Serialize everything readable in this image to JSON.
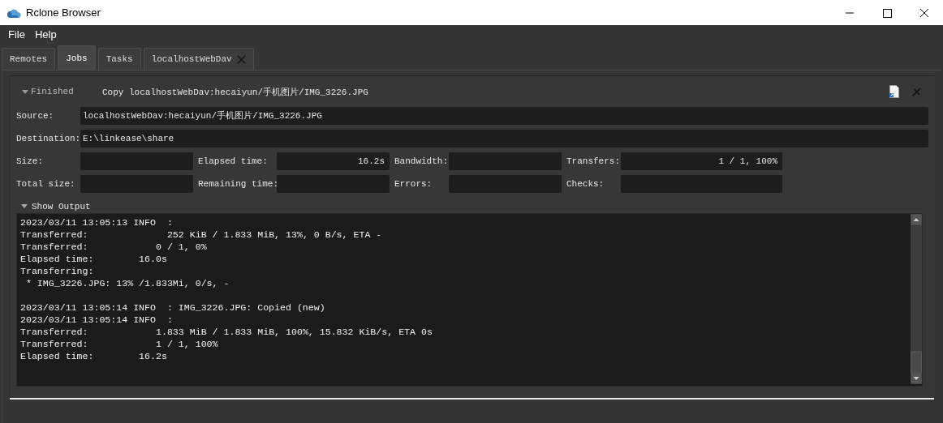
{
  "window": {
    "title": "Rclone Browser"
  },
  "menu": [
    {
      "label": "File"
    },
    {
      "label": "Help"
    }
  ],
  "tabs": [
    {
      "label": "Remotes",
      "selected": false,
      "closable": false
    },
    {
      "label": "Jobs",
      "selected": true,
      "closable": false
    },
    {
      "label": "Tasks",
      "selected": false,
      "closable": false
    },
    {
      "label": "localhostWebDav",
      "selected": false,
      "closable": true
    }
  ],
  "job": {
    "expanded": true,
    "status": "Finished",
    "title": "Copy localhostWebDav:hecaiyun/手机图片/IMG_3226.JPG",
    "source": {
      "label": "Source:",
      "value": "localhostWebDav:hecaiyun/手机图片/IMG_3226.JPG"
    },
    "destination": {
      "label": "Destination:",
      "value": "E:\\linkease\\share"
    },
    "stats": [
      {
        "label": "Size:"
      },
      {
        "label": "Elapsed time:",
        "value": "16.2s"
      },
      {
        "label": "Bandwidth:"
      },
      {
        "label": "Transfers:",
        "value": "1 / 1, 100%"
      },
      {
        "label": "Total size:"
      },
      {
        "label": "Remaining time:"
      },
      {
        "label": "Errors:"
      },
      {
        "label": "Checks:"
      }
    ],
    "output_toggle": {
      "label": "Show Output",
      "expanded": true
    },
    "output": [
      {
        "text": "2023/03/11 13:05:13 INFO  :",
        "gap_before": false
      },
      {
        "text": "Transferred:   \t          252 KiB / 1.833 MiB, 13%, 0 B/s, ETA -",
        "gap_before": false
      },
      {
        "text": "Transferred:            0 / 1, 0%",
        "gap_before": false
      },
      {
        "text": "Elapsed time:        16.0s",
        "gap_before": false
      },
      {
        "text": "Transferring:",
        "gap_before": false
      },
      {
        "text": " * IMG_3226.JPG: 13% /1.833Mi, 0/s, -",
        "gap_before": false
      },
      {
        "text": "2023/03/11 13:05:14 INFO  : IMG_3226.JPG: Copied (new)",
        "gap_before": true
      },
      {
        "text": "2023/03/11 13:05:14 INFO  :",
        "gap_before": false
      },
      {
        "text": "Transferred:   \t        1.833 MiB / 1.833 MiB, 100%, 15.832 KiB/s, ETA 0s",
        "gap_before": false
      },
      {
        "text": "Transferred:            1 / 1, 100%",
        "gap_before": false
      },
      {
        "text": "Elapsed time:        16.2s",
        "gap_before": false
      }
    ]
  }
}
